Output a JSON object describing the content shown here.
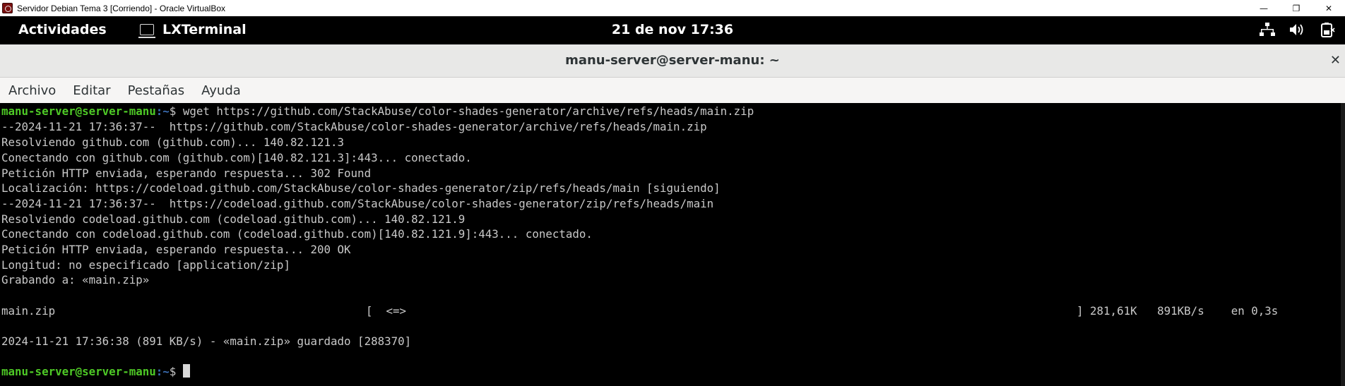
{
  "host_window": {
    "title": "Servidor Debian Tema 3 [Corriendo] - Oracle VirtualBox",
    "minimize": "—",
    "restore": "❐",
    "close": "✕"
  },
  "topbar": {
    "activities": "Actividades",
    "app_name": "LXTerminal",
    "clock": "21 de nov  17:36",
    "icons": [
      "network-icon",
      "volume-icon",
      "battery-icon"
    ]
  },
  "terminal_window": {
    "title": "manu-server@server-manu: ~",
    "close": "✕",
    "menu": [
      "Archivo",
      "Editar",
      "Pestañas",
      "Ayuda"
    ]
  },
  "terminal": {
    "prompt_user": "manu-server@server-manu",
    "prompt_dir": ":~",
    "prompt_sym": "$ ",
    "command": "wget https://github.com/StackAbuse/color-shades-generator/archive/refs/heads/main.zip",
    "output": [
      "--2024-11-21 17:36:37--  https://github.com/StackAbuse/color-shades-generator/archive/refs/heads/main.zip",
      "Resolviendo github.com (github.com)... 140.82.121.3",
      "Conectando con github.com (github.com)[140.82.121.3]:443... conectado.",
      "Petición HTTP enviada, esperando respuesta... 302 Found",
      "Localización: https://codeload.github.com/StackAbuse/color-shades-generator/zip/refs/heads/main [siguiendo]",
      "--2024-11-21 17:36:37--  https://codeload.github.com/StackAbuse/color-shades-generator/zip/refs/heads/main",
      "Resolviendo codeload.github.com (codeload.github.com)... 140.82.121.9",
      "Conectando con codeload.github.com (codeload.github.com)[140.82.121.9]:443... conectado.",
      "Petición HTTP enviada, esperando respuesta... 200 OK",
      "Longitud: no especificado [application/zip]",
      "Grabando a: «main.zip»"
    ],
    "progress": {
      "filename": "main.zip",
      "bar": "[  <=>",
      "end": "] 281,61K   891KB/s    en 0,3s"
    },
    "saved": "2024-11-21 17:36:38 (891 KB/s) - «main.zip» guardado [288370]",
    "colors": {
      "user": "#4ec926",
      "dir": "#3b6eb4",
      "text": "#c9c9c9",
      "bg": "#000000"
    }
  }
}
